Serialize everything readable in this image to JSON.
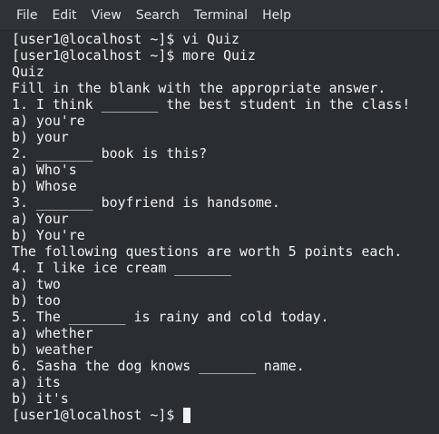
{
  "menu": [
    "File",
    "Edit",
    "View",
    "Search",
    "Terminal",
    "Help"
  ],
  "terminal": {
    "lines": [
      "[user1@localhost ~]$ vi Quiz",
      "[user1@localhost ~]$ more Quiz",
      "Quiz",
      "Fill in the blank with the appropriate answer.",
      "1. I think _______ the best student in the class!",
      "a) you're",
      "b) your",
      "2. _______ book is this?",
      "a) Who's",
      "b) Whose",
      "3. _______ boyfriend is handsome.",
      "a) Your",
      "b) You're",
      "The following questions are worth 5 points each.",
      "4. I like ice cream _______",
      "a) two",
      "b) too",
      "5. The _______ is rainy and cold today.",
      "a) whether",
      "b) weather",
      "6. Sasha the dog knows _______ name.",
      "a) its",
      "b) it's"
    ],
    "prompt": "[user1@localhost ~]$ "
  }
}
